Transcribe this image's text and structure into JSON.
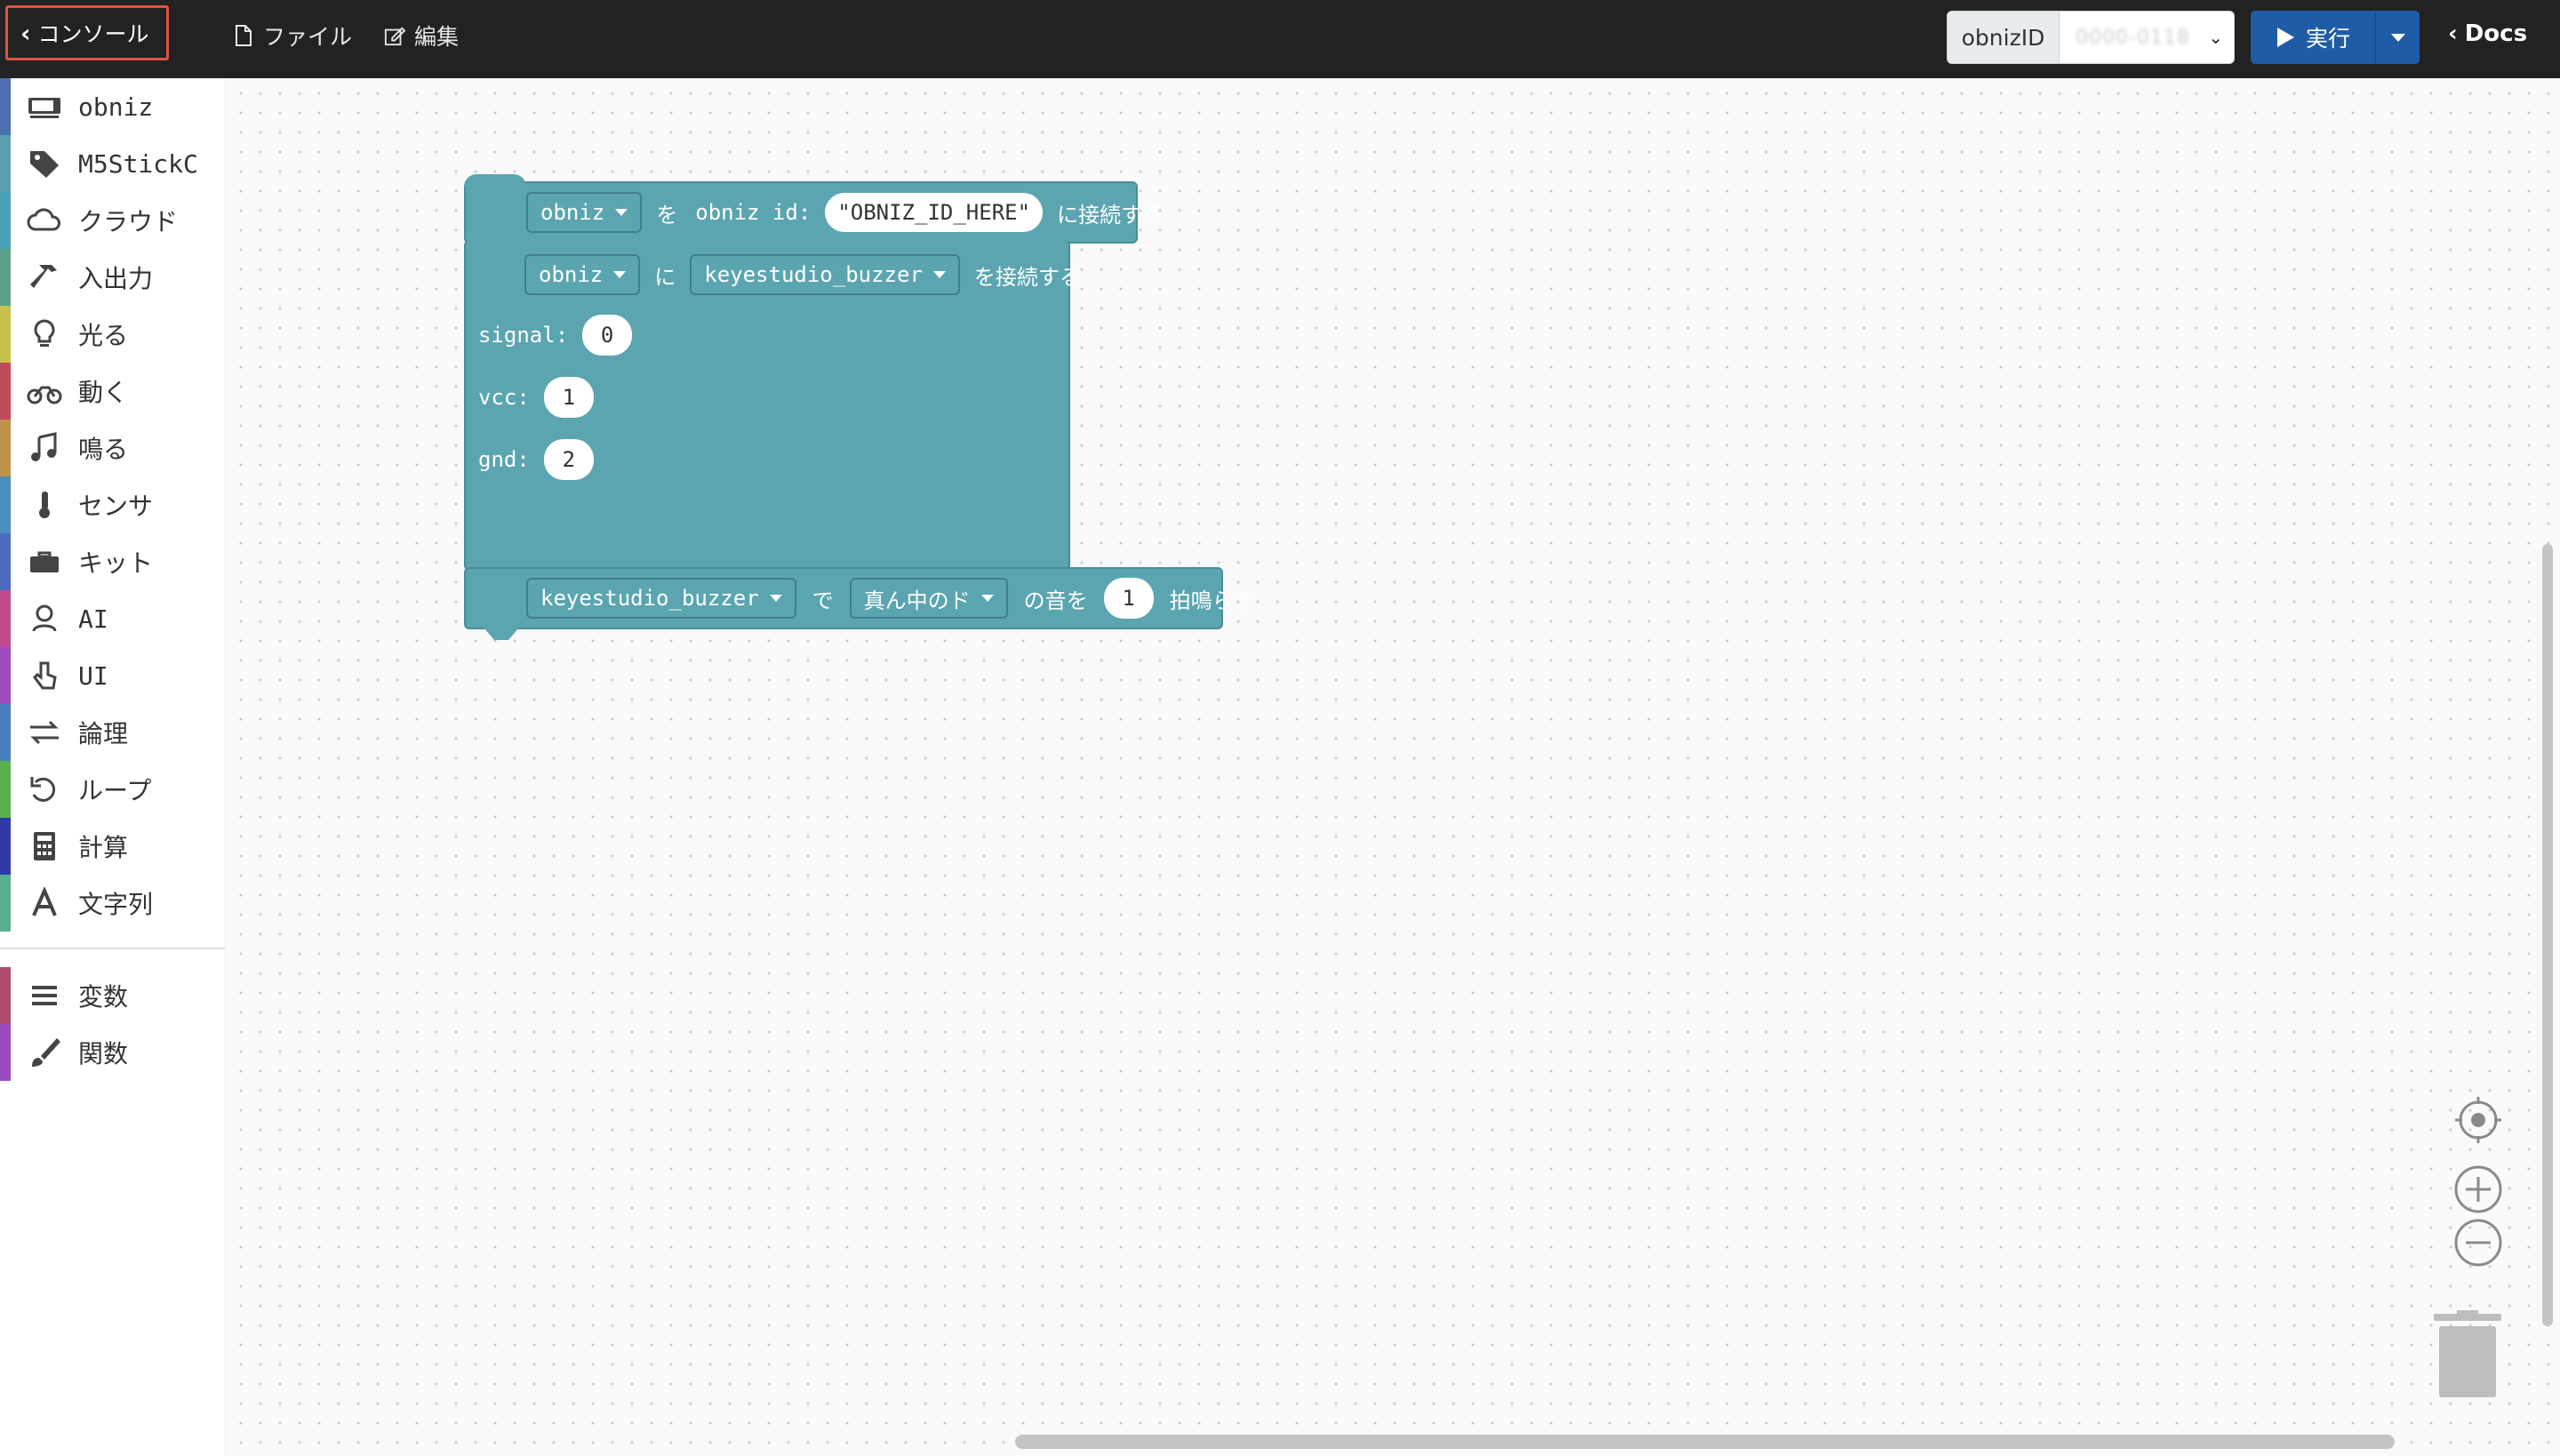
{
  "topbar": {
    "console_label": "コンソール",
    "file_label": "ファイル",
    "edit_label": "編集",
    "obniz_id_label": "obnizID",
    "obniz_id_value": "0000-0118",
    "run_label": "実行",
    "docs_label": "Docs"
  },
  "sidebar": {
    "categories": [
      {
        "label": "obniz",
        "icon": "device-icon",
        "color": "#4c6fb0"
      },
      {
        "label": "M5StickC",
        "icon": "tag-icon",
        "color": "#5c9fb0"
      },
      {
        "label": "クラウド",
        "icon": "cloud-icon",
        "color": "#4b9fb3"
      },
      {
        "label": "入出力",
        "icon": "hammer-icon",
        "color": "#5aa08a"
      },
      {
        "label": "光る",
        "icon": "lightbulb-icon",
        "color": "#c9c14b"
      },
      {
        "label": "動く",
        "icon": "motorcycle-icon",
        "color": "#c04b5b"
      },
      {
        "label": "鳴る",
        "icon": "music-icon",
        "color": "#c0924b"
      },
      {
        "label": "センサ",
        "icon": "thermometer-icon",
        "color": "#4b8ec0"
      },
      {
        "label": "キット",
        "icon": "toolbox-icon",
        "color": "#4b6bc0"
      },
      {
        "label": "AI",
        "icon": "robot-icon",
        "color": "#c04b8e"
      },
      {
        "label": "UI",
        "icon": "pointer-icon",
        "color": "#a04bc0"
      },
      {
        "label": "論理",
        "icon": "exchange-icon",
        "color": "#4b7ec0"
      },
      {
        "label": "ループ",
        "icon": "undo-icon",
        "color": "#5ab04b"
      },
      {
        "label": "計算",
        "icon": "calculator-icon",
        "color": "#2f3aa8"
      },
      {
        "label": "文字列",
        "icon": "font-icon",
        "color": "#5ab08e"
      }
    ],
    "extra": [
      {
        "label": "変数",
        "icon": "list-icon",
        "color": "#b04b6e"
      },
      {
        "label": "関数",
        "icon": "brush-icon",
        "color": "#9a4bc0"
      }
    ]
  },
  "blocks": {
    "connect": {
      "obniz_var": "obniz",
      "text_wo": "を",
      "text_id": "obniz id:",
      "id_string": "OBNIZ_ID_HERE",
      "text_connect": "に接続する"
    },
    "wire": {
      "obniz_var": "obniz",
      "text_ni": "に",
      "part": "keyestudio_buzzer",
      "text_connect": "を接続する",
      "signal_label": "signal:",
      "signal_value": "0",
      "vcc_label": "vcc:",
      "vcc_value": "1",
      "gnd_label": "gnd:",
      "gnd_value": "2"
    },
    "play": {
      "part": "keyestudio_buzzer",
      "text_de": "で",
      "note": "真ん中のド",
      "text_note": "の音を",
      "beats": "1",
      "text_beats": "拍鳴らす"
    }
  },
  "colors": {
    "topbar": "#222222",
    "accent_run": "#1f5ca8",
    "block": "#5ba5b0",
    "console_border": "#e0533f"
  }
}
